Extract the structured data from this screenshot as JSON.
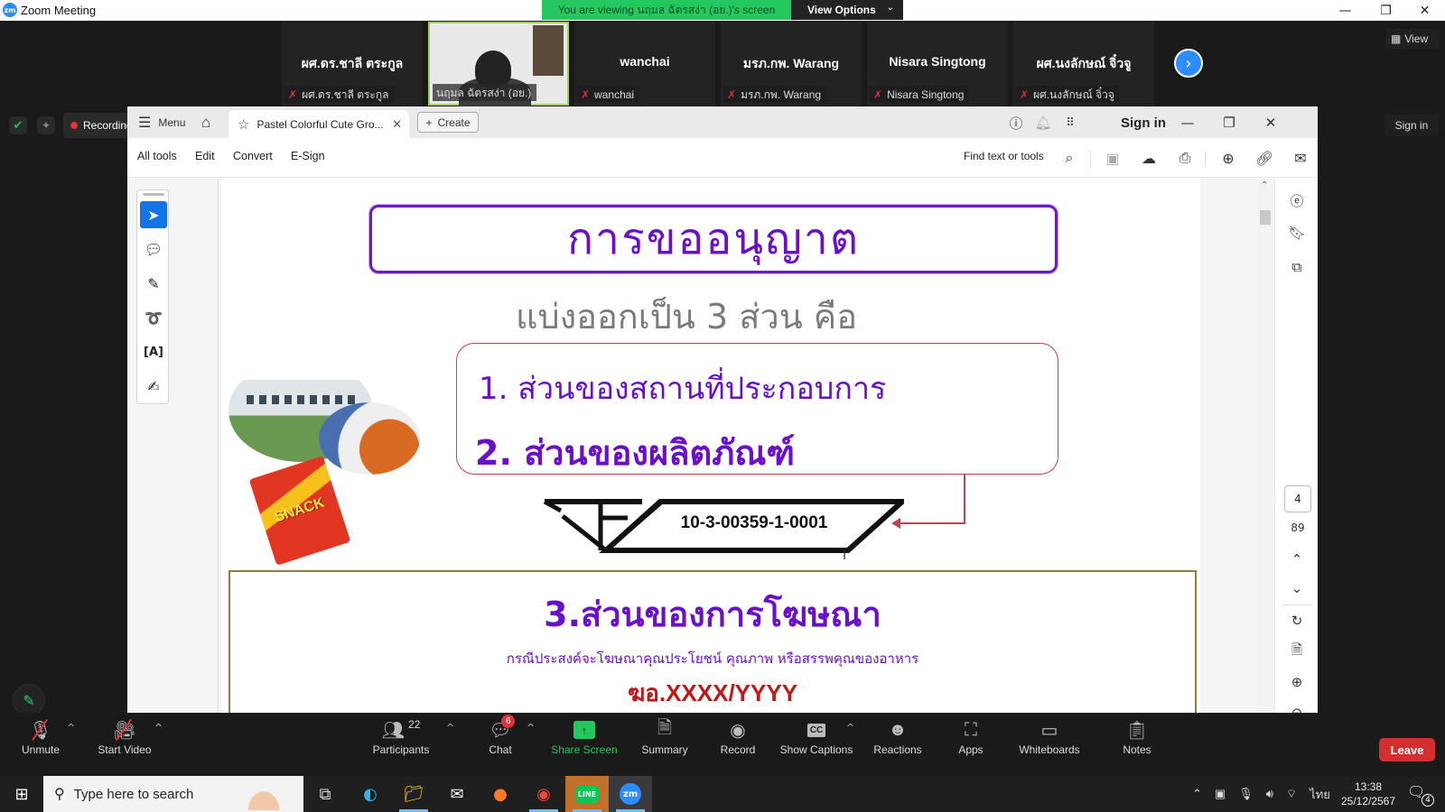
{
  "window": {
    "app_title": "Zoom Meeting",
    "viewing_banner": "You are viewing นฤมล ฉัตรสง่า (อย.)'s screen",
    "view_options_label": "View Options"
  },
  "participants": [
    {
      "display": "ผศ.ดร.ชาลี ตระกูล",
      "tag": "ผศ.ดร.ชาลี ตระกูล",
      "muted": true,
      "video": false
    },
    {
      "display": "",
      "tag": "นฤมล ฉัตรสง่า (อย.)",
      "muted": false,
      "video": true
    },
    {
      "display": "wanchai",
      "tag": "wanchai",
      "muted": true,
      "video": false
    },
    {
      "display": "มรภ.กพ. Warang",
      "tag": "มรภ.กพ. Warang",
      "muted": true,
      "video": false
    },
    {
      "display": "Nisara Singtong",
      "tag": "Nisara Singtong",
      "muted": true,
      "video": false
    },
    {
      "display": "ผศ.นงลักษณ์ จิ๋วจู",
      "tag": "ผศ.นงลักษณ์ จิ๋วจู",
      "muted": true,
      "video": false
    }
  ],
  "zoom_overlay": {
    "view_label": "View",
    "recording_label": "Recording",
    "sign_in_label": "Sign in"
  },
  "acrobat": {
    "menu_label": "Menu",
    "doc_tab_title": "Pastel Colorful Cute Gro...",
    "create_label": "Create",
    "sign_in_label": "Sign in",
    "menu_items": [
      "All tools",
      "Edit",
      "Convert",
      "E-Sign"
    ],
    "find_placeholder": "Find text or tools",
    "current_page": "4",
    "total_pages": "89"
  },
  "slide": {
    "title": "การขออนุญาต",
    "subtitle": "แบ่งออกเป็น 3 ส่วน คือ",
    "part1": "1. ส่วนของสถานที่ประกอบการ",
    "part2": "2. ส่วนของผลิตภัณฑ์",
    "registration_number": "10-3-00359-1-0001",
    "snack_label": "SNACK",
    "part3_title": "3.ส่วนของการโฆษณา",
    "part3_desc": "กรณีประสงค์จะโฆษณาคุณประโยชน์ คุณภาพ หรือสรรพคุณของอาหาร",
    "part3_code": "ฆอ.XXXX/YYYY"
  },
  "meeting_controls": {
    "unmute": "Unmute",
    "start_video": "Start Video",
    "participants": "Participants",
    "participants_count": "22",
    "chat": "Chat",
    "chat_badge": "6",
    "share_screen": "Share Screen",
    "summary": "Summary",
    "record": "Record",
    "show_captions": "Show Captions",
    "reactions": "Reactions",
    "apps": "Apps",
    "whiteboards": "Whiteboards",
    "notes": "Notes",
    "leave": "Leave"
  },
  "taskbar": {
    "search_placeholder": "Type here to search",
    "language": "ไทย",
    "time": "13:38",
    "date": "25/12/2567",
    "notification_count": "4"
  },
  "colors": {
    "slide_purple": "#6a10c8",
    "slide_red": "#c01818",
    "zoom_blue": "#2d8cff",
    "share_green": "#24c760",
    "leave_red": "#d32f2f",
    "acrobat_blue": "#1473e6"
  }
}
